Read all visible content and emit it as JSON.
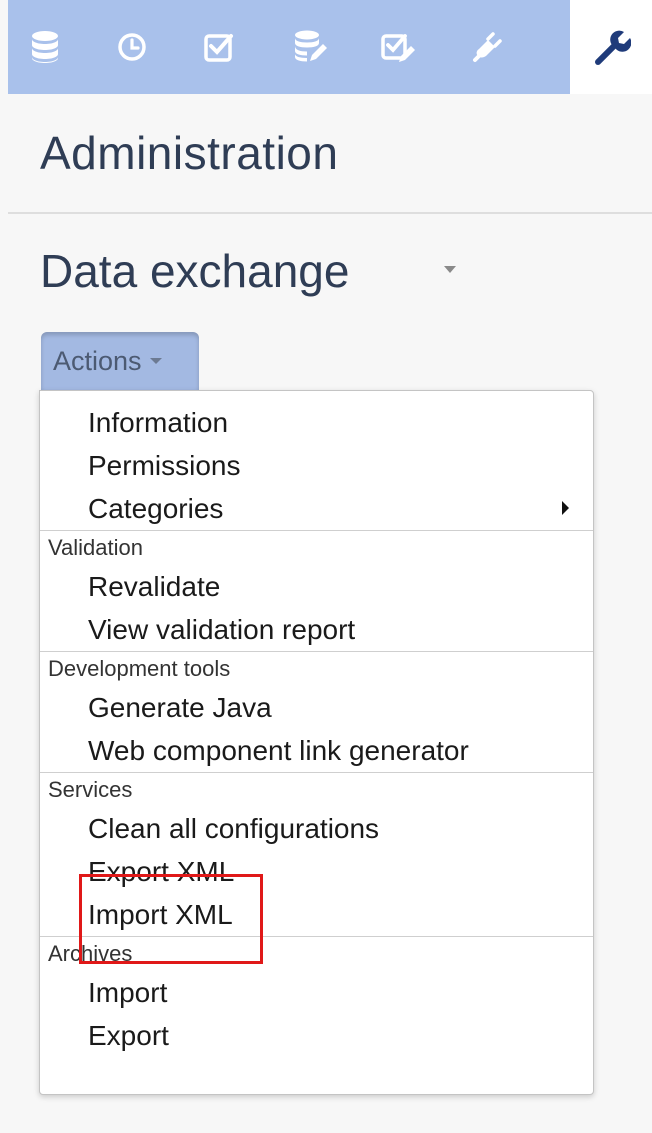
{
  "nav": {
    "icons": [
      {
        "name": "database-icon",
        "color": "#ffffff"
      },
      {
        "name": "clock-icon",
        "color": "#ffffff"
      },
      {
        "name": "checkbox-icon",
        "color": "#ffffff"
      },
      {
        "name": "database-edit-icon",
        "color": "#ffffff"
      },
      {
        "name": "checkbox-edit-icon",
        "color": "#ffffff"
      },
      {
        "name": "plug-icon",
        "color": "#ffffff"
      }
    ],
    "active_icon": "wrench-icon",
    "bar_color": "#a9c1eb",
    "active_icon_color": "#1f3b7a"
  },
  "header": {
    "title": "Administration"
  },
  "section": {
    "title": "Data exchange"
  },
  "actions": {
    "label": "Actions"
  },
  "menu": {
    "general": {
      "items": [
        "Information",
        "Permissions",
        "Categories"
      ]
    },
    "validation": {
      "header": "Validation",
      "items": [
        "Revalidate",
        "View validation report"
      ]
    },
    "development": {
      "header": "Development tools",
      "items": [
        "Generate Java",
        "Web component link generator"
      ]
    },
    "services": {
      "header": "Services",
      "items": [
        "Clean all configurations",
        "Export XML",
        "Import XML"
      ]
    },
    "archives": {
      "header": "Archives",
      "items": [
        "Import",
        "Export"
      ]
    }
  },
  "highlight": {
    "color": "#e01818"
  }
}
